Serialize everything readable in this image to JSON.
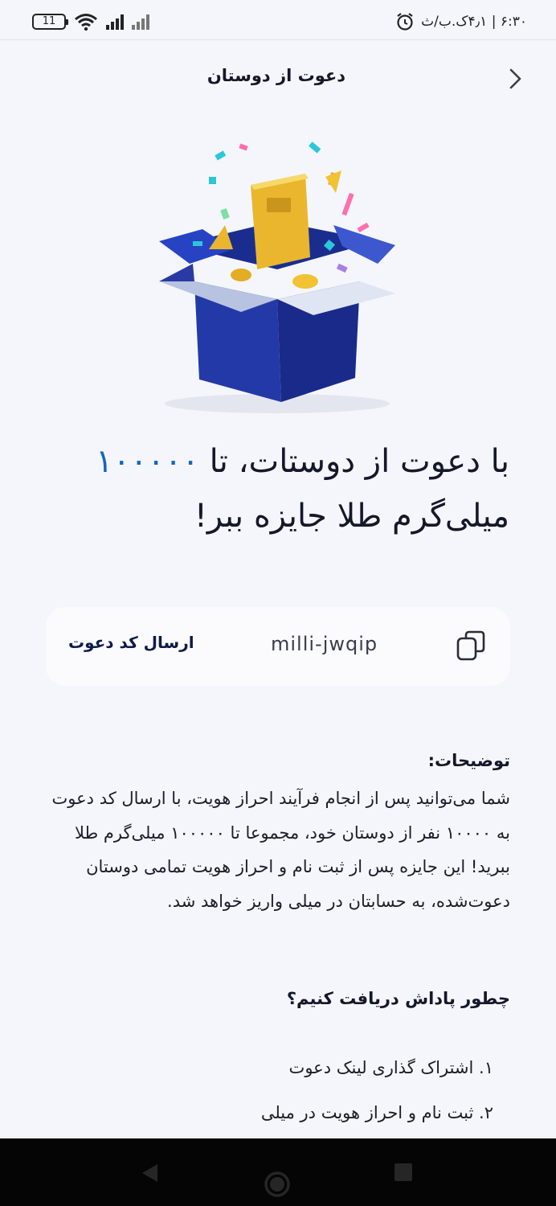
{
  "status_bar": {
    "battery_level": "11",
    "time_text": "۶:۳۰ | ۴٫۱ک.ب/ث"
  },
  "header": {
    "title": "دعوت از دوستان",
    "back_icon": "chevron-right-icon"
  },
  "hero": {
    "headline_before": "با دعوت از دوستات، تا ",
    "headline_amount": "۱۰۰۰۰۰",
    "headline_after": " میلی‌گرم طلا جایزه ببر!",
    "accent_color": "#1565c0"
  },
  "invite": {
    "code": "milli-jwqip",
    "send_label": "ارسال کد دعوت",
    "copy_icon": "copy-icon"
  },
  "description": {
    "title": "توضیحات:",
    "body": "شما می‌توانید پس از انجام فرآیند احراز هویت، با ارسال کد دعوت به ۱۰۰۰۰ نفر از دوستان خود، مجموعا تا ۱۰۰۰۰۰ میلی‌گرم طلا ببرید! این جایزه پس از ثبت نام و احراز هویت تمامی دوستان دعوت‌شده، به حسابتان در میلی واریز خواهد شد."
  },
  "how_to": {
    "title": "چطور پاداش دریافت کنیم؟",
    "steps": [
      "۱. اشتراک گذاری لینک دعوت",
      "۲. ثبت نام و احراز هویت در میلی"
    ]
  }
}
